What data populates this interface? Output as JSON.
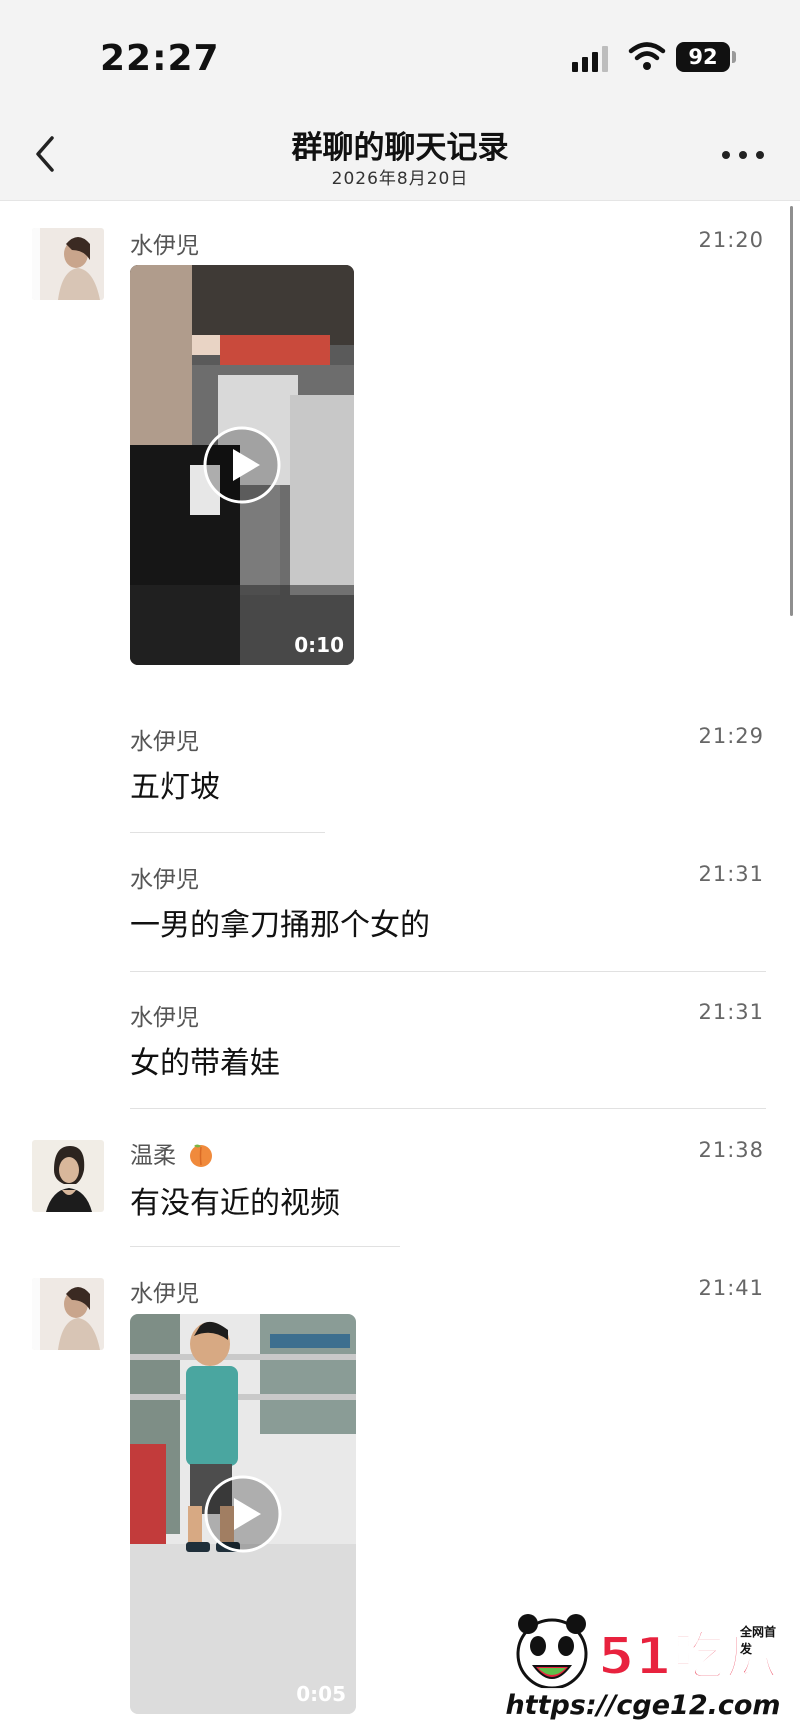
{
  "status_bar": {
    "time": "22:27",
    "battery": "92"
  },
  "header": {
    "title": "群聊的聊天记录",
    "subtitle": "2026年8月20日"
  },
  "messages": [
    {
      "sender": "水伊児",
      "time": "21:20",
      "type": "video",
      "duration": "0:10"
    },
    {
      "sender": "水伊児",
      "time": "21:29",
      "type": "text",
      "text": "五灯坡"
    },
    {
      "sender": "水伊児",
      "time": "21:31",
      "type": "text",
      "text": "一男的拿刀捅那个女的"
    },
    {
      "sender": "水伊児",
      "time": "21:31",
      "type": "text",
      "text": "女的带着娃"
    },
    {
      "sender": "温柔",
      "time": "21:38",
      "type": "text",
      "text": "有没有近的视频"
    },
    {
      "sender": "水伊児",
      "time": "21:41",
      "type": "video",
      "duration": "0:05"
    }
  ],
  "watermark": {
    "brand": "51吃瓜",
    "tagline": "全网首发",
    "url": "https://cge12.com"
  },
  "colors": {
    "header_bg": "#f3f3f3",
    "divider": "#e1e1e1",
    "watermark_accent": "#e8223e"
  }
}
